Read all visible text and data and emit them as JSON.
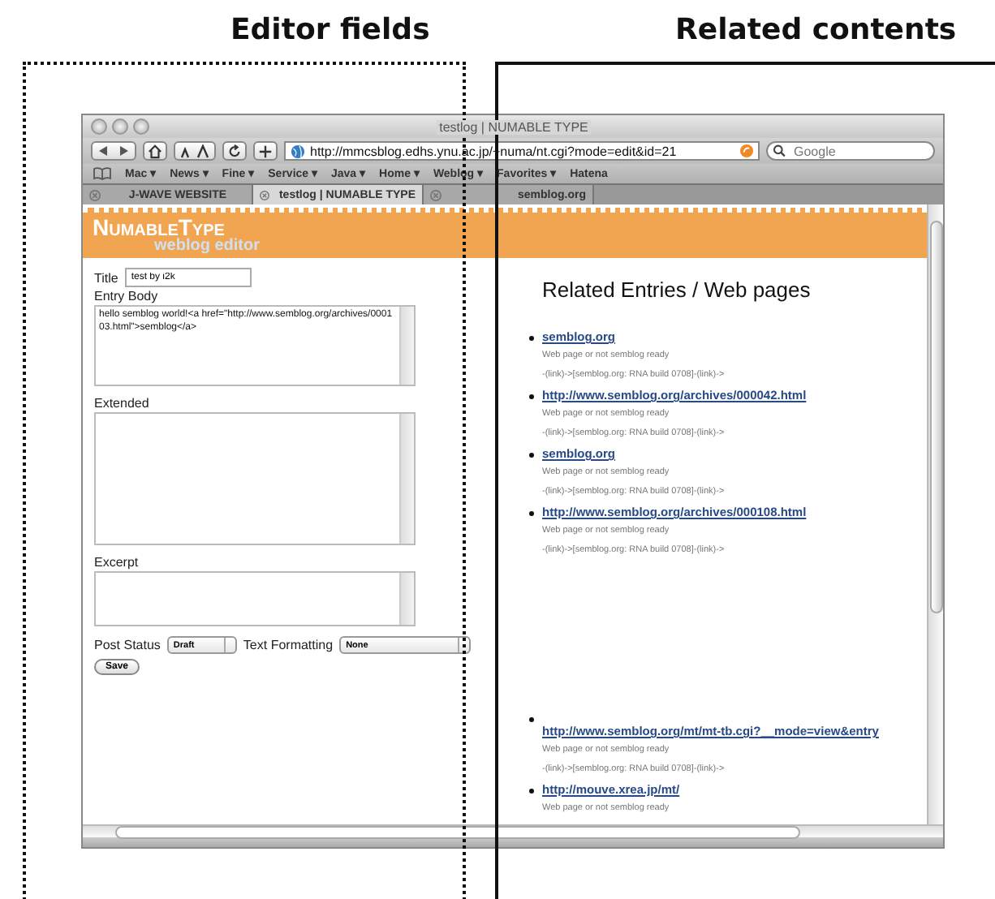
{
  "annotations": [
    {
      "label": "Editor fields",
      "kind": "dotted"
    },
    {
      "label": "Related contents",
      "kind": "solid"
    }
  ],
  "window": {
    "title": "testlog | NUMABLE TYPE",
    "url": "http://mmcsblog.edhs.ynu.ac.jp/~numa/nt.cgi?mode=edit&id=21",
    "search_placeholder": "Google",
    "bookmarks": [
      {
        "label": "Mac ▾"
      },
      {
        "label": "News ▾"
      },
      {
        "label": "Fine ▾"
      },
      {
        "label": "Service ▾"
      },
      {
        "label": "Java ▾"
      },
      {
        "label": "Home ▾"
      },
      {
        "label": "Weblog ▾"
      },
      {
        "label": "Favorites ▾"
      },
      {
        "label": "Hatena"
      }
    ],
    "tabs": [
      {
        "label": "J-WAVE WEBSITE",
        "selected": false
      },
      {
        "label": "testlog | NUMABLE TYPE",
        "selected": true
      },
      {
        "label": "semblog.org",
        "selected": false
      }
    ]
  },
  "header": {
    "logo": "NumableType",
    "subtitle": "weblog editor"
  },
  "editor": {
    "title_label": "Title",
    "title_value": "test by i2k",
    "body_label": "Entry Body",
    "body_value": "hello semblog world!<a href=\"http://www.semblog.org/archives/000103.html\">semblog</a>",
    "extended_label": "Extended",
    "excerpt_label": "Excerpt",
    "status_label": "Post Status",
    "status_value": "Draft",
    "format_label": "Text Formatting",
    "format_value": "None",
    "save": "Save"
  },
  "related": {
    "heading": "Related Entries / Web pages",
    "items": [
      {
        "link": "semblog.org",
        "wrapped": false,
        "lines": [
          "Web page or not semblog ready",
          "-(link)->[semblog.org: RNA build 0708]-(link)->"
        ]
      },
      {
        "link": "http://www.semblog.org/archives/000042.html",
        "wrapped": false,
        "lines": [
          "Web page or not semblog ready",
          "-(link)->[semblog.org: RNA build 0708]-(link)->"
        ]
      },
      {
        "link": "semblog.org",
        "wrapped": false,
        "lines": [
          "Web page or not semblog ready",
          "-(link)->[semblog.org: RNA build 0708]-(link)->"
        ]
      },
      {
        "link": "http://www.semblog.org/archives/000108.html",
        "wrapped": false,
        "lines": [
          "Web page or not semblog ready",
          "-(link)->[semblog.org: RNA build 0708]-(link)->"
        ]
      },
      {
        "link": "http://www.semblog.org/mt/mt-tb.cgi?__mode=view&entry",
        "wrapped": true,
        "lines": [
          "Web page or not semblog ready",
          "-(link)->[semblog.org: RNA build 0708]-(link)->"
        ]
      },
      {
        "link": "http://mouve.xrea.jp/mt/",
        "wrapped": false,
        "lines": [
          "Web page or not semblog ready"
        ]
      }
    ]
  }
}
